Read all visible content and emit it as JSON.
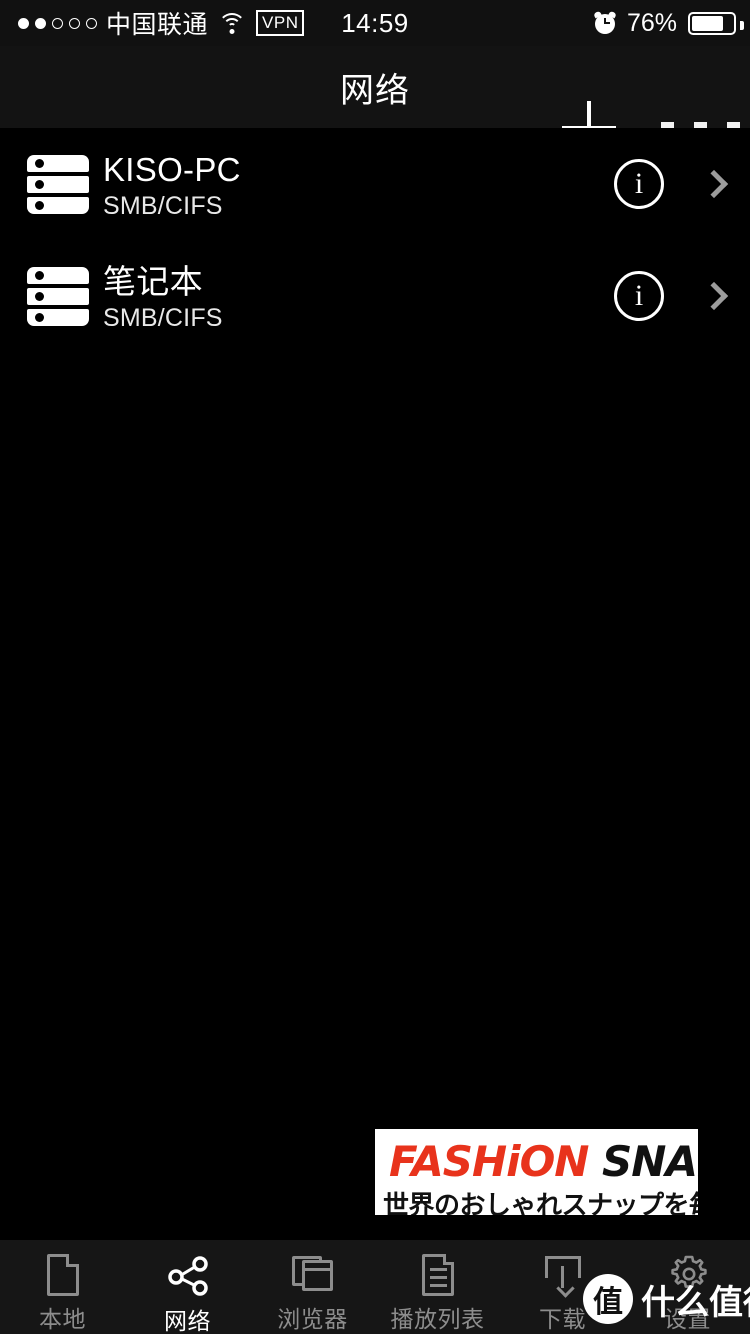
{
  "status_bar": {
    "signal_dots_filled": 2,
    "signal_dots_total": 5,
    "carrier": "中国联通",
    "wifi_icon": "wifi-icon",
    "vpn_label": "VPN",
    "time": "14:59",
    "alarm_icon": "alarm-clock-icon",
    "battery_percent": "76%",
    "battery_level": 76
  },
  "navbar": {
    "title": "网络",
    "add_icon": "plus-icon",
    "more_icon": "more-options-icon"
  },
  "list": {
    "items": [
      {
        "icon": "server-icon",
        "name": "KISO-PC",
        "protocol": "SMB/CIFS",
        "info_label": "i",
        "chevron_icon": "chevron-right-icon"
      },
      {
        "icon": "server-icon",
        "name": "笔记本",
        "protocol": "SMB/CIFS",
        "info_label": "i",
        "chevron_icon": "chevron-right-icon"
      }
    ]
  },
  "ad": {
    "brand_red": "FASHiON",
    "brand_black": " SNAP",
    "subtitle": "世界のおしゃれスナップを毎日更",
    "red_hex": "#e8331c"
  },
  "tabbar": {
    "items": [
      {
        "icon": "file-icon",
        "label": "本地",
        "active": false
      },
      {
        "icon": "share-icon",
        "label": "网络",
        "active": true
      },
      {
        "icon": "browser-icon",
        "label": "浏览器",
        "active": false
      },
      {
        "icon": "playlist-icon",
        "label": "播放列表",
        "active": false
      },
      {
        "icon": "download-icon",
        "label": "下载",
        "active": false
      },
      {
        "icon": "gear-icon",
        "label": "设置",
        "active": false
      }
    ]
  },
  "watermark": {
    "logo_char": "值",
    "text": "什么值得买"
  }
}
